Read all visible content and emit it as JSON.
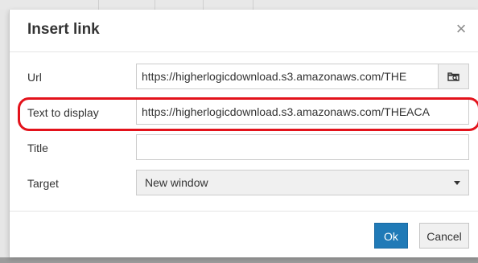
{
  "dialog": {
    "title": "Insert link",
    "close_glyph": "×",
    "close_icon": "close-icon"
  },
  "fields": {
    "url": {
      "label": "Url",
      "value": "https://higherlogicdownload.s3.amazonaws.com/THE",
      "browse_icon": "folder-search-icon"
    },
    "text_to_display": {
      "label": "Text to display",
      "value": "https://higherlogicdownload.s3.amazonaws.com/THEACA"
    },
    "title": {
      "label": "Title",
      "value": ""
    },
    "target": {
      "label": "Target",
      "selected": "New window"
    }
  },
  "buttons": {
    "ok": "Ok",
    "cancel": "Cancel"
  },
  "colors": {
    "highlight_ring": "#e3121b",
    "primary_button": "#207ab7"
  }
}
